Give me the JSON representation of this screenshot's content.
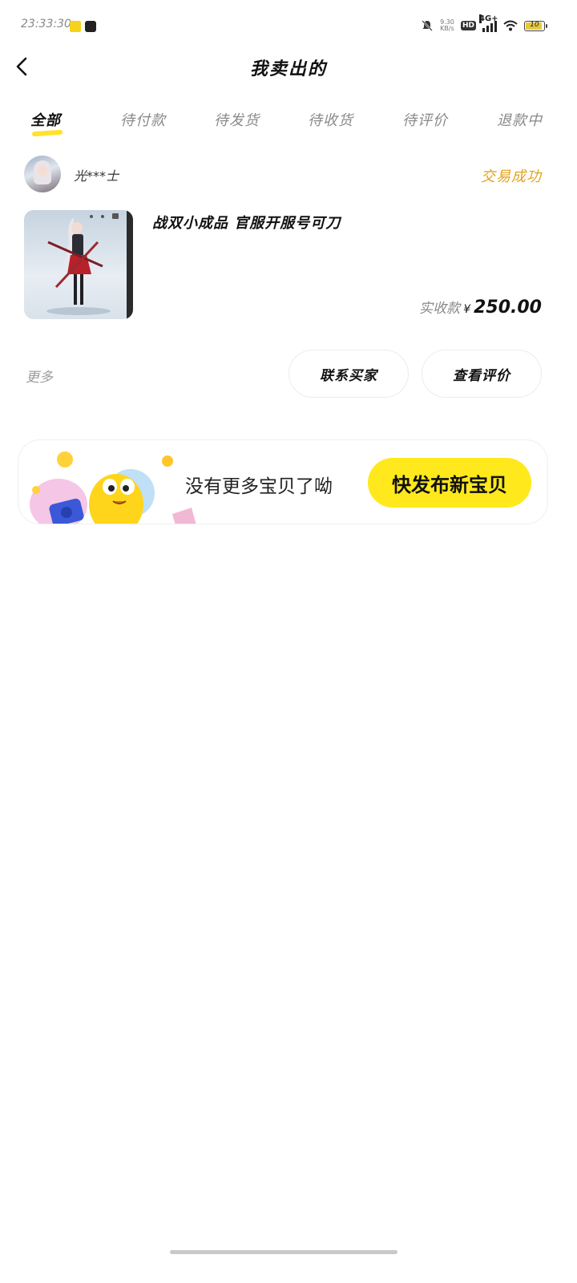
{
  "status_bar": {
    "time": "23:33:30",
    "net_speed_top": "9.30",
    "net_speed_bottom": "KB/s",
    "hd": "HD",
    "network": "4G+",
    "battery": "10"
  },
  "nav": {
    "title": "我卖出的"
  },
  "tabs": [
    {
      "label": "全部",
      "active": true
    },
    {
      "label": "待付款",
      "active": false
    },
    {
      "label": "待发货",
      "active": false
    },
    {
      "label": "待收货",
      "active": false
    },
    {
      "label": "待评价",
      "active": false
    },
    {
      "label": "退款中",
      "active": false
    }
  ],
  "order": {
    "seller_name": "光***士",
    "status": "交易成功",
    "product_title": "战双小成品 官服开服号可刀",
    "price_label": "实收款",
    "price_symbol": "¥",
    "price_value": "250.00",
    "more_label": "更多",
    "contact_button": "联系买家",
    "review_button": "查看评价"
  },
  "banner": {
    "text": "没有更多宝贝了呦",
    "button": "快发布新宝贝"
  },
  "colors": {
    "accent_yellow": "#ffe91c",
    "status_orange": "#e3a21a"
  }
}
